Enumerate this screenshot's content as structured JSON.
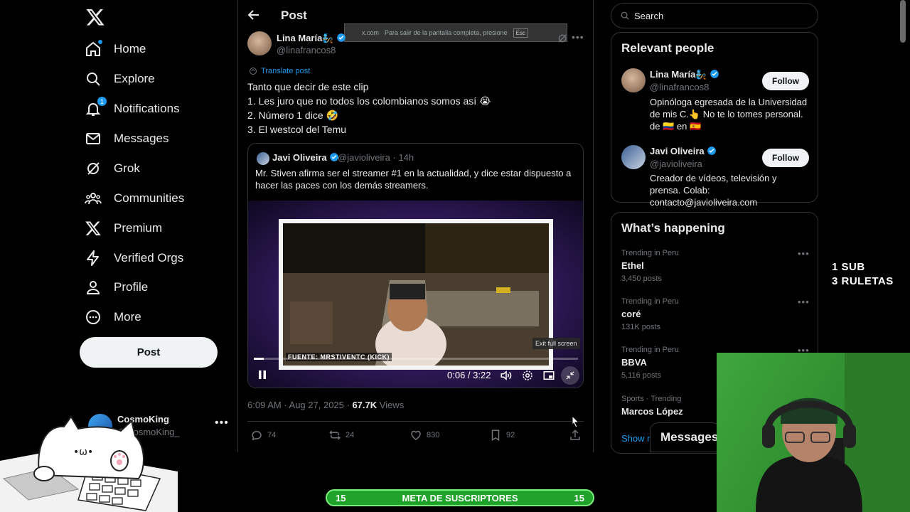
{
  "nav": {
    "items": [
      {
        "label": "Home",
        "icon": "home-icon"
      },
      {
        "label": "Explore",
        "icon": "search-icon"
      },
      {
        "label": "Notifications",
        "icon": "bell-icon",
        "badge": "1"
      },
      {
        "label": "Messages",
        "icon": "envelope-icon"
      },
      {
        "label": "Grok",
        "icon": "grok-icon"
      },
      {
        "label": "Communities",
        "icon": "people-icon"
      },
      {
        "label": "Premium",
        "icon": "x-logo-icon"
      },
      {
        "label": "Verified Orgs",
        "icon": "lightning-icon"
      },
      {
        "label": "Profile",
        "icon": "person-icon"
      },
      {
        "label": "More",
        "icon": "more-circle-icon"
      }
    ],
    "post_button": "Post",
    "account": {
      "name": "CosmoKing",
      "handle": "@CosmoKing_"
    }
  },
  "header": {
    "title": "Post"
  },
  "fullscreen_notice": {
    "text": "Para salir de la pantalla completa, presione",
    "key": "Esc",
    "site": "x.com"
  },
  "post": {
    "author_name": "Lina María🧞",
    "author_handle": "@linafrancos8",
    "translate_label": "Translate post",
    "text": "Tanto que decir de este clip\n1. Les juro que no todos los colombianos somos así 😭\n2. Número 1 dice 🤣\n3. El westcol del Temu",
    "quote": {
      "author_name": "Javi Oliveira",
      "author_handle": "@javioliveira · 14h",
      "text": "Mr. Stiven afirma ser el streamer #1 en la actualidad, y dice estar dispuesto a hacer las paces con los demás streamers.",
      "video": {
        "caption": "FUENTE: MRSTIVENTC (KICK)",
        "tooltip": "Exit full screen",
        "time": "0:06 / 3:22",
        "progress": 0.03
      }
    },
    "timestamp": "6:09 AM · Aug 27, 2025 · ",
    "views_count": "67.7K",
    "views_label": " Views",
    "actions": {
      "replies": "74",
      "reposts": "24",
      "likes": "830",
      "bookmarks": "92"
    }
  },
  "search": {
    "placeholder": "Search"
  },
  "relevant_people": {
    "title": "Relevant people",
    "people": [
      {
        "name": "Lina María🧞",
        "handle": "@linafrancos8",
        "bio": "Opinóloga egresada de la Universidad de mis C.👆 No te lo tomes personal. de 🇨🇴 en 🇪🇸",
        "follow": "Follow"
      },
      {
        "name": "Javi Oliveira",
        "handle": "@javioliveira",
        "bio": "Creador de vídeos, televisión y prensa. Colab: contacto@javioliveira.com",
        "follow": "Follow"
      }
    ]
  },
  "trends": {
    "title": "What’s happening",
    "items": [
      {
        "meta": "Trending in Peru",
        "name": "Ethel",
        "count": "3,450 posts"
      },
      {
        "meta": "Trending in Peru",
        "name": "coré",
        "count": "131K posts"
      },
      {
        "meta": "Trending in Peru",
        "name": "BBVA",
        "count": "5,116 posts"
      },
      {
        "meta": "Sports · Trending",
        "name": "Marcos López",
        "count": ""
      }
    ],
    "show_more": "Show more"
  },
  "messages_drawer": {
    "label": "Messages"
  },
  "stream_overlay": {
    "sub_line1": "1 SUB",
    "sub_line2": "3 RULETAS",
    "goal_left": "15",
    "goal_label": "META DE SUSCRIPTORES",
    "goal_right": "15"
  },
  "colors": {
    "accent": "#1d9bf0",
    "background": "#000000",
    "goal_bar": "#1fa32a"
  }
}
